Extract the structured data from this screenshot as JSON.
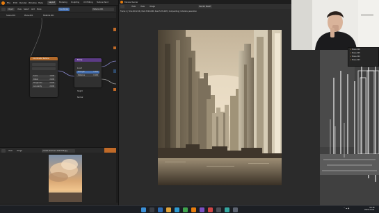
{
  "topbar": {
    "menus": [
      "File",
      "Edit",
      "Render",
      "Window",
      "Help"
    ],
    "workspaces": [
      "Layout",
      "Modeling",
      "Sculpting",
      "UV Editing",
      "Texture Paint"
    ],
    "active_workspace": "Layout"
  },
  "node_editor": {
    "header_items": [
      "Object",
      "View",
      "Select",
      "Add",
      "Node",
      "Use Nodes"
    ],
    "material_name": "Material.001",
    "breadcrumb": [
      "Scene.001",
      "Plane.001",
      "Material.001"
    ],
    "nodes": {
      "texcoord": {
        "title": "Coordinate Texture"
      },
      "bump": {
        "title": "Bump",
        "rows": [
          "Invert",
          "Strength",
          "Distance",
          "Height",
          "Normal"
        ],
        "strength": "0.350",
        "distance": "0.100"
      },
      "fields_values": [
        "1.000",
        "2.000",
        "2.000",
        "2.000"
      ],
      "fields_labels": [
        "Scale",
        "Detail",
        "Roughness",
        "Lacunarity"
      ]
    }
  },
  "image_editor": {
    "header_items": [
      "View",
      "Image"
    ],
    "filename": "pexels-eberhard-1903768.jpg"
  },
  "render_window": {
    "title": "Blender Render",
    "menus": [
      "View",
      "View",
      "Image"
    ],
    "info": "Frame:1 | Time:00:02.06 | Mem:3594.00M, Peak 5135.42M | Compositing | Initializing execution",
    "slot": "Render Result"
  },
  "outliner": {
    "items": [
      "Plane.006",
      "Plane.005",
      "Plane.004",
      "Plane.003"
    ]
  },
  "taskbar": {
    "time": "00:18",
    "date": "2022-10-01"
  },
  "colors": {
    "accent_orange": "#c06a28",
    "node_purple": "#5c3b86",
    "node_blue": "#2f4b6c",
    "node_orange": "#b36a2a"
  }
}
